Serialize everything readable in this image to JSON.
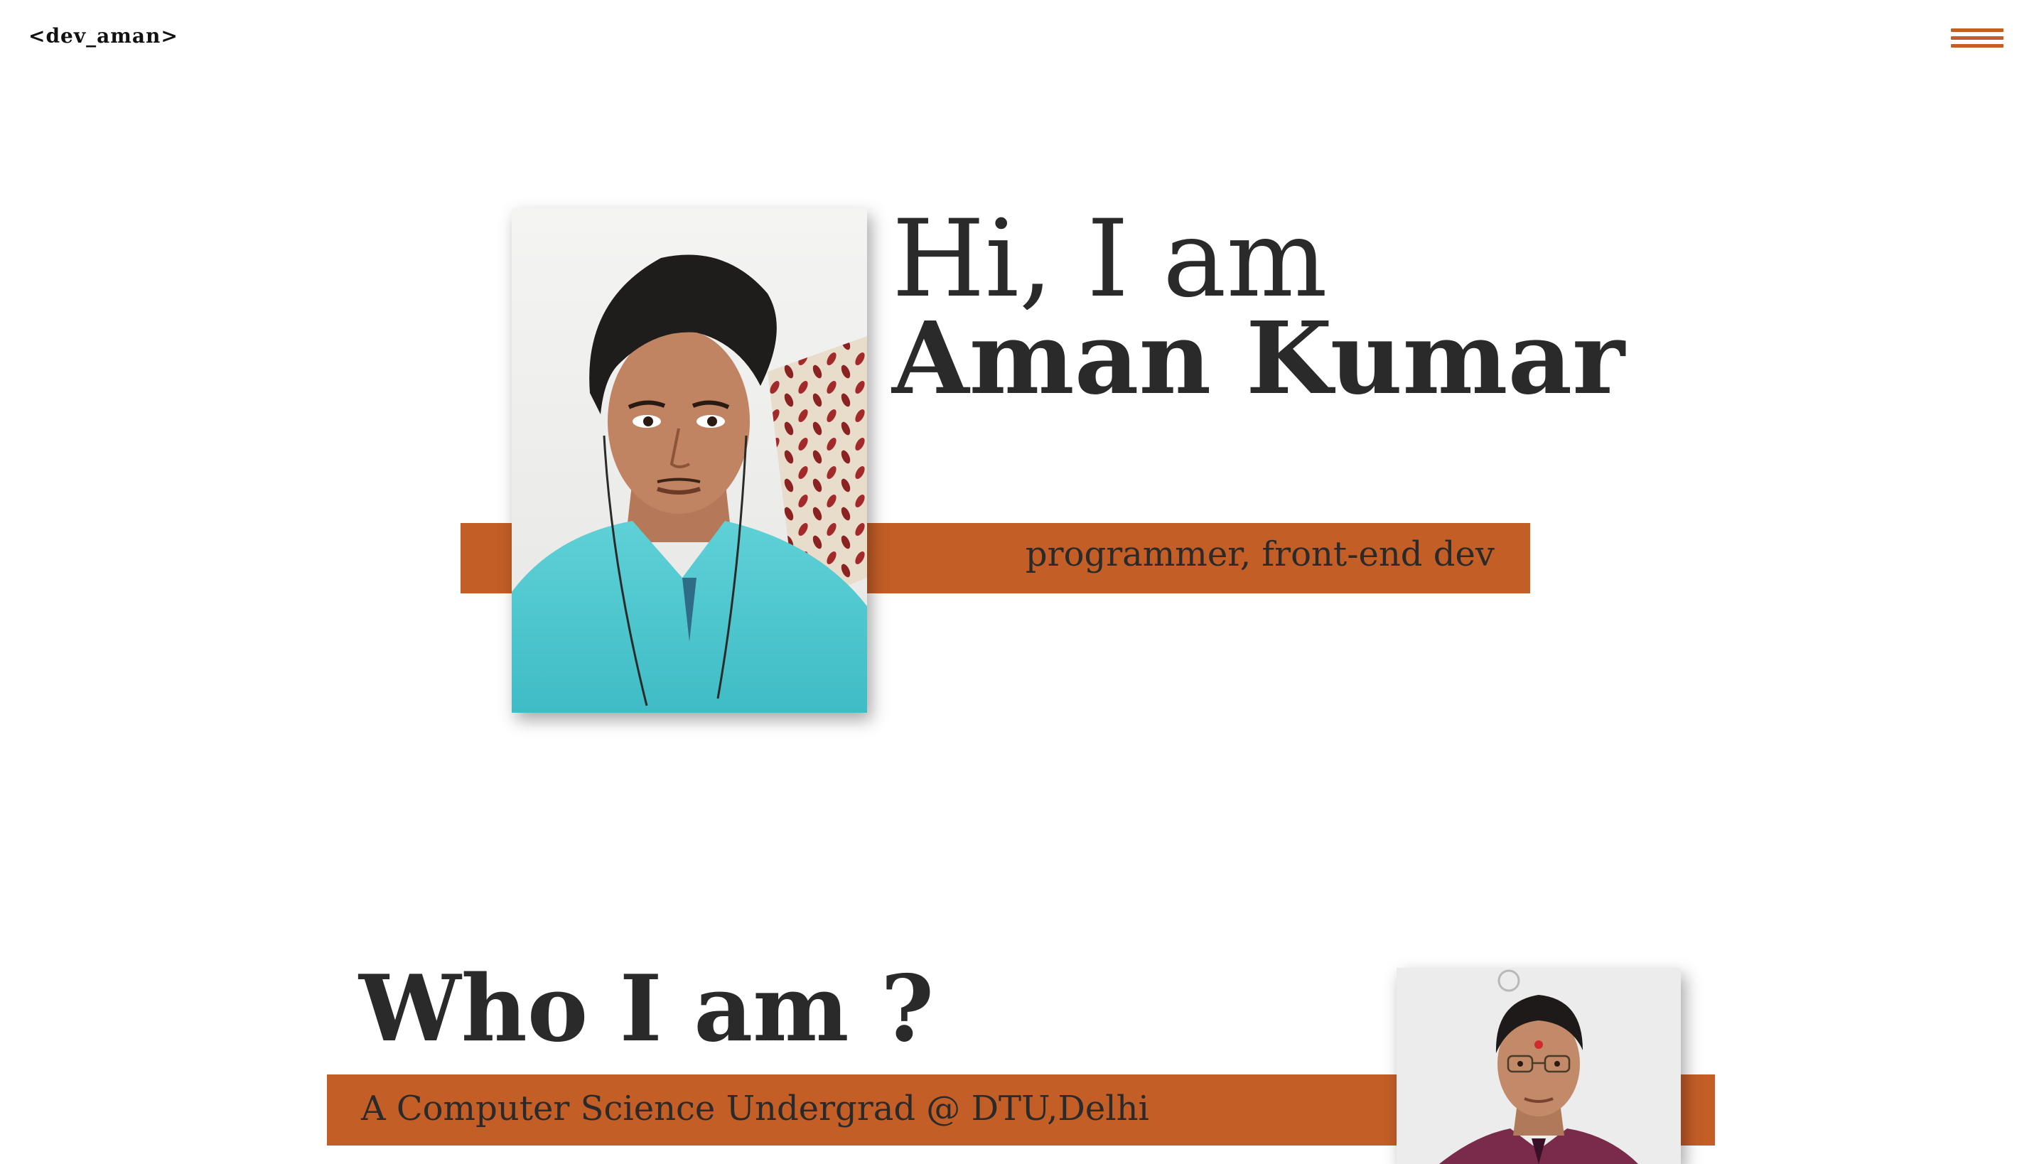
{
  "header": {
    "logo": "<dev_aman>",
    "menu_icon": "hamburger-icon"
  },
  "hero": {
    "greeting": "Hi, I am",
    "name": "Aman Kumar",
    "role": "programmer, front-end dev"
  },
  "about": {
    "title": "Who I am ?",
    "subtitle": "A Computer Science Undergrad @ DTU,Delhi"
  },
  "colors": {
    "accent": "#c45e27",
    "text": "#2a2a2a",
    "background": "#ffffff"
  }
}
